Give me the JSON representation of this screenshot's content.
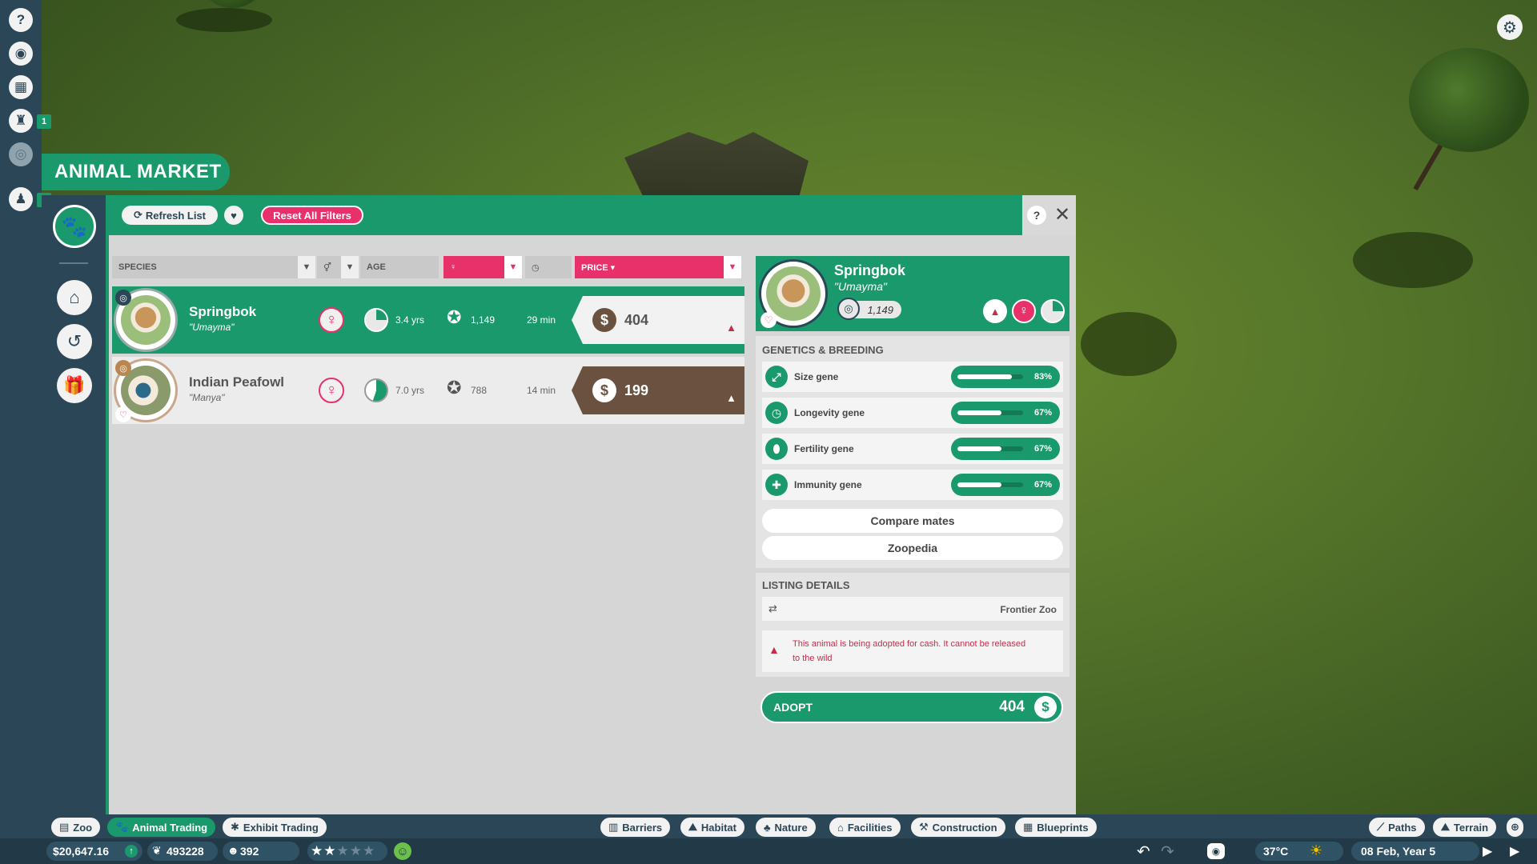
{
  "window": {
    "title": "ANIMAL MARKET"
  },
  "rail": {
    "badges": [
      "1",
      "1"
    ]
  },
  "header": {
    "refresh_label": "Refresh List",
    "reset_label": "Reset All Filters",
    "help_label": "?",
    "close_label": "✕"
  },
  "filters": {
    "species": "SPECIES",
    "age": "AGE",
    "price": "PRICE ▾"
  },
  "listings": [
    {
      "name": "Springbok",
      "nickname": "\"Umayma\"",
      "gender": "♀",
      "age": "3.4 yrs",
      "popularity": "1,149",
      "time": "29 min",
      "price": "404"
    },
    {
      "name": "Indian Peafowl",
      "nickname": "\"Manya\"",
      "gender": "♀",
      "age": "7.0 yrs",
      "popularity": "788",
      "time": "14 min",
      "price": "199"
    }
  ],
  "detail": {
    "name": "Springbok",
    "nickname": "\"Umayma\"",
    "popularity": "1,149",
    "genetics_title": "GENETICS & BREEDING",
    "genes": [
      {
        "label": "Size gene",
        "pct": "83%",
        "value": 0.83,
        "icon": "size-icon"
      },
      {
        "label": "Longevity gene",
        "pct": "67%",
        "value": 0.67,
        "icon": "clock-icon"
      },
      {
        "label": "Fertility gene",
        "pct": "67%",
        "value": 0.67,
        "icon": "fertility-icon"
      },
      {
        "label": "Immunity gene",
        "pct": "67%",
        "value": 0.67,
        "icon": "immunity-icon"
      }
    ],
    "compare_label": "Compare mates",
    "zoopedia_label": "Zoopedia",
    "listing_title": "LISTING DETAILS",
    "seller": "Frontier Zoo",
    "warning": "This animal is being adopted for cash. It cannot be released to the wild",
    "adopt_label": "ADOPT",
    "adopt_price": "404"
  },
  "toolbar": {
    "zoo": "Zoo",
    "animal_trading": "Animal Trading",
    "exhibit_trading": "Exhibit Trading",
    "barriers": "Barriers",
    "habitat": "Habitat",
    "nature": "Nature",
    "facilities": "Facilities",
    "construction": "Construction",
    "blueprints": "Blueprints",
    "paths": "Paths",
    "terrain": "Terrain"
  },
  "status": {
    "money": "$20,647.16",
    "conservation": "493228",
    "guests": "392",
    "rating_stars": 2,
    "temperature": "37°C",
    "date": "08 Feb, Year 5"
  },
  "colors": {
    "accent": "#1a9a6c",
    "pink": "#e8306a",
    "navy": "#2b4656",
    "brown_tag": "#6b5240"
  }
}
